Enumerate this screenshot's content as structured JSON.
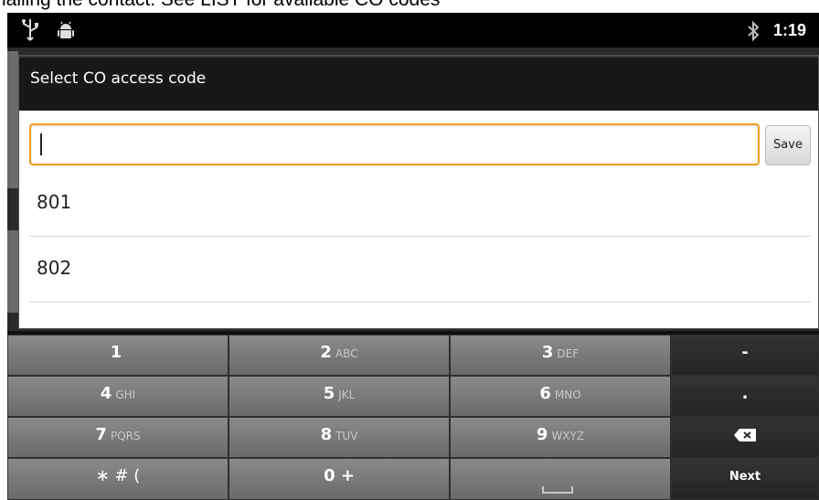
{
  "caption": "ialling the contact. See LIST for available CO codes",
  "statusbar": {
    "time": "1:19",
    "icons": [
      "usb-icon",
      "android-debug-icon",
      "bluetooth-icon"
    ]
  },
  "dialog": {
    "title": "Select CO access code",
    "input": {
      "value": "",
      "placeholder": ""
    },
    "save_label": "Save",
    "codes": [
      "801",
      "802"
    ]
  },
  "keyboard": {
    "rows": [
      [
        {
          "main": "1",
          "sub": ""
        },
        {
          "main": "2",
          "sub": "ABC"
        },
        {
          "main": "3",
          "sub": "DEF"
        },
        {
          "main": "-",
          "sub": ""
        }
      ],
      [
        {
          "main": "4",
          "sub": "GHI"
        },
        {
          "main": "5",
          "sub": "JKL"
        },
        {
          "main": "6",
          "sub": "MNO"
        },
        {
          "main": ".",
          "sub": ""
        }
      ],
      [
        {
          "main": "7",
          "sub": "PQRS"
        },
        {
          "main": "8",
          "sub": "TUV"
        },
        {
          "main": "9",
          "sub": "WXYZ"
        },
        {
          "main": "",
          "sub": ""
        }
      ],
      [
        {
          "main": "∗ # (",
          "sub": ""
        },
        {
          "main": "0 +",
          "sub": ""
        },
        {
          "main": "",
          "sub": ""
        },
        {
          "main": "Next",
          "sub": ""
        }
      ]
    ],
    "colors": {
      "accent_focus": "#f39c1f",
      "key_light": "#7a7a7a",
      "key_dark": "#2c2c2c"
    }
  }
}
